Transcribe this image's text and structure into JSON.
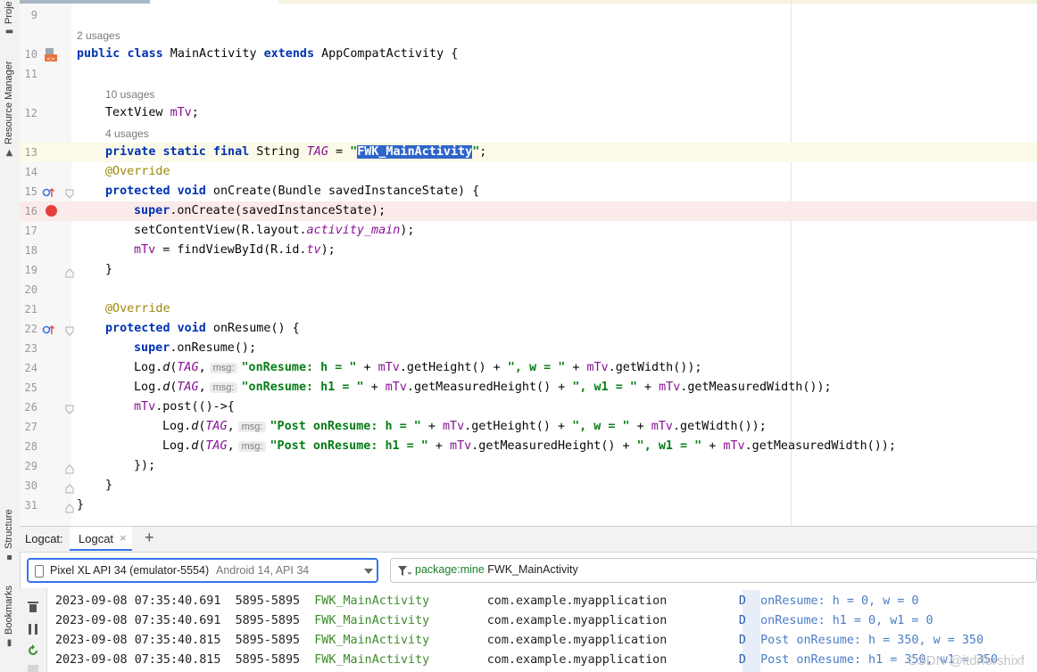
{
  "sidebar": {
    "project_label": "Proje",
    "resource_manager_label": "Resource Manager",
    "structure_label": "Structure",
    "bookmarks_label": "Bookmarks"
  },
  "hints": {
    "class_usages": "2 usages",
    "mtv_usages": "10 usages",
    "tag_usages": "4 usages",
    "msg": "msg:"
  },
  "line_numbers": [
    "9",
    "10",
    "11",
    "12",
    "13",
    "14",
    "15",
    "16",
    "17",
    "18",
    "19",
    "20",
    "21",
    "22",
    "23",
    "24",
    "25",
    "26",
    "27",
    "28",
    "29",
    "30",
    "31"
  ],
  "code": {
    "l10_public": "public",
    "l10_class": "class",
    "l10_name": " MainActivity ",
    "l10_extends": "extends",
    "l10_rest": " AppCompatActivity {",
    "l12_type": "TextView ",
    "l12_field": "mTv",
    "l12_semi": ";",
    "l13_mods": "private static final",
    "l13_type": " String ",
    "l13_tag": "TAG",
    "l13_eq": " = ",
    "l13_q1": "\"",
    "l13_sel": "FWK_MainActivity",
    "l13_q2": "\"",
    "l13_semi": ";",
    "l14_ann": "@Override",
    "l15_mods": "protected void",
    "l15_rest": " onCreate(Bundle savedInstanceState) {",
    "l16_super": "super",
    "l16_rest": ".onCreate(savedInstanceState);",
    "l17_a": "setContentView(R.layout.",
    "l17_b": "activity_main",
    "l17_c": ");",
    "l18_a": "mTv",
    "l18_b": " = findViewById(R.id.",
    "l18_c": "tv",
    "l18_d": ");",
    "l19": "}",
    "l21_ann": "@Override",
    "l22_mods": "protected void",
    "l22_rest": " onResume() {",
    "l23_super": "super",
    "l23_rest": ".onResume();",
    "l24_log": "Log.",
    "l24_d": "d",
    "l24_open": "(",
    "l24_tag": "TAG",
    "l24_comma": ",",
    "l24_str1": "\"onResume: h = \"",
    "l24_plus1": " + ",
    "l24_mtv1": "mTv",
    "l24_get1": ".getHeight() + ",
    "l24_str2": "\", w = \"",
    "l24_plus2": " + ",
    "l24_mtv2": "mTv",
    "l24_get2": ".getWidth());",
    "l25_log": "Log.",
    "l25_d": "d",
    "l25_open": "(",
    "l25_tag": "TAG",
    "l25_comma": ",",
    "l25_str1": "\"onResume: h1 = \"",
    "l25_plus1": " + ",
    "l25_mtv1": "mTv",
    "l25_get1": ".getMeasuredHeight() + ",
    "l25_str2": "\", w1 = \"",
    "l25_plus2": " + ",
    "l25_mtv2": "mTv",
    "l25_get2": ".getMeasuredWidth());",
    "l26_a": "mTv",
    "l26_b": ".post(()->{",
    "l27_log": "Log.",
    "l27_d": "d",
    "l27_open": "(",
    "l27_tag": "TAG",
    "l27_comma": ",",
    "l27_str1": "\"Post onResume: h = \"",
    "l27_plus1": " + ",
    "l27_mtv1": "mTv",
    "l27_get1": ".getHeight() + ",
    "l27_str2": "\", w = \"",
    "l27_plus2": " + ",
    "l27_mtv2": "mTv",
    "l27_get2": ".getWidth());",
    "l28_log": "Log.",
    "l28_d": "d",
    "l28_open": "(",
    "l28_tag": "TAG",
    "l28_comma": ",",
    "l28_str1": "\"Post onResume: h1 = \"",
    "l28_plus1": " + ",
    "l28_mtv1": "mTv",
    "l28_get1": ".getMeasuredHeight() + ",
    "l28_str2": "\", w1 = \"",
    "l28_plus2": " + ",
    "l28_mtv2": "mTv",
    "l28_get2": ".getMeasuredWidth());",
    "l29": "});",
    "l30": "}",
    "l31": "}"
  },
  "logcat": {
    "panel_label": "Logcat:",
    "tab_label": "Logcat",
    "close_glyph": "×",
    "add_glyph": "+",
    "device": "Pixel XL API 34 (emulator-5554)",
    "device_os": "Android 14, API 34",
    "filter_key": "package:mine",
    "filter_rest": " FWK_MainActivity",
    "rows": [
      {
        "date": "2023-09-08",
        "time": "07:35:40.691",
        "pid": "5895-5895",
        "tag": "FWK_MainActivity",
        "pkg": "com.example.myapplication",
        "level": "D",
        "msg": "onResume: h = 0, w = 0"
      },
      {
        "date": "2023-09-08",
        "time": "07:35:40.691",
        "pid": "5895-5895",
        "tag": "FWK_MainActivity",
        "pkg": "com.example.myapplication",
        "level": "D",
        "msg": "onResume: h1 = 0, w1 = 0"
      },
      {
        "date": "2023-09-08",
        "time": "07:35:40.815",
        "pid": "5895-5895",
        "tag": "FWK_MainActivity",
        "pkg": "com.example.myapplication",
        "level": "D",
        "msg": "Post onResume: h = 350, w = 350"
      },
      {
        "date": "2023-09-08",
        "time": "07:35:40.815",
        "pid": "5895-5895",
        "tag": "FWK_MainActivity",
        "pkg": "com.example.myapplication",
        "level": "D",
        "msg": "Post onResume: h1 = 350, w1 = 350"
      }
    ]
  },
  "watermark": "CSDN @itdrforshixf",
  "colors": {
    "keyword": "#0033b3",
    "string": "#067d17",
    "field": "#871094",
    "annotation": "#9e880d",
    "selection": "#2f65ca",
    "caret_line": "#fcfae8",
    "breakpoint_line": "#fbeaea",
    "breakpoint": "#e53e3e",
    "log_tag": "#3d8c2b",
    "log_msg": "#4a7cc7"
  }
}
